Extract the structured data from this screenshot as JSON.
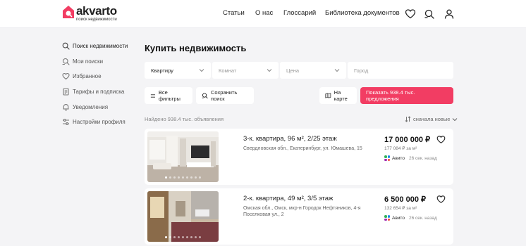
{
  "header": {
    "logo_name": "akvarto",
    "logo_sub": "поиск недвижимости",
    "nav": [
      "Статьи",
      "О нас",
      "Глоссарий",
      "Библиотека документов"
    ],
    "icons": [
      "heart-icon",
      "search-saved-icon",
      "user-icon"
    ]
  },
  "sidebar": {
    "items": [
      {
        "label": "Поиск недвижимости",
        "icon": "search-icon",
        "active": true
      },
      {
        "label": "Мои поиски",
        "icon": "saved-search-icon"
      },
      {
        "label": "Избранное",
        "icon": "heart-icon"
      },
      {
        "label": "Тарифы и подписка",
        "icon": "document-icon"
      },
      {
        "label": "Уведомления",
        "icon": "bell-icon"
      },
      {
        "label": "Настройки профиля",
        "icon": "settings-icon"
      }
    ]
  },
  "main": {
    "title": "Купить недвижимость",
    "filters": {
      "type_value": "Квартиру",
      "rooms_placeholder": "Комнат",
      "price_placeholder": "Цена",
      "city_placeholder": "Город"
    },
    "buttons": {
      "all_filters": "Все фильтры",
      "save_search": "Сохранить поиск",
      "map": "На карте",
      "show": "Показать 938.4 тыс. предложения"
    },
    "found_text": "Найдено 938.4 тыс. объявления",
    "sort_label": "сначала новые",
    "accent_color": "#f23d63"
  },
  "listings": [
    {
      "title": "3-к. квартира, 96 м², 2/25 этаж",
      "address": "Свердловская обл., Екатеринбург, ул. Юмашева, 15",
      "price": "17 000 000 ₽",
      "price_per_m2": "177 084 ₽ за м²",
      "source": "Авито",
      "time": "26 сек. назад"
    },
    {
      "title": "2-к. квартира, 49 м², 3/5 этаж",
      "address": "Омская обл., Омск, мкр-н Городок Нефтяников, 4-я Поселковая ул., 2",
      "price": "6 500 000 ₽",
      "price_per_m2": "132 654 ₽ за м²",
      "source": "Авито",
      "time": "26 сек. назад"
    }
  ]
}
